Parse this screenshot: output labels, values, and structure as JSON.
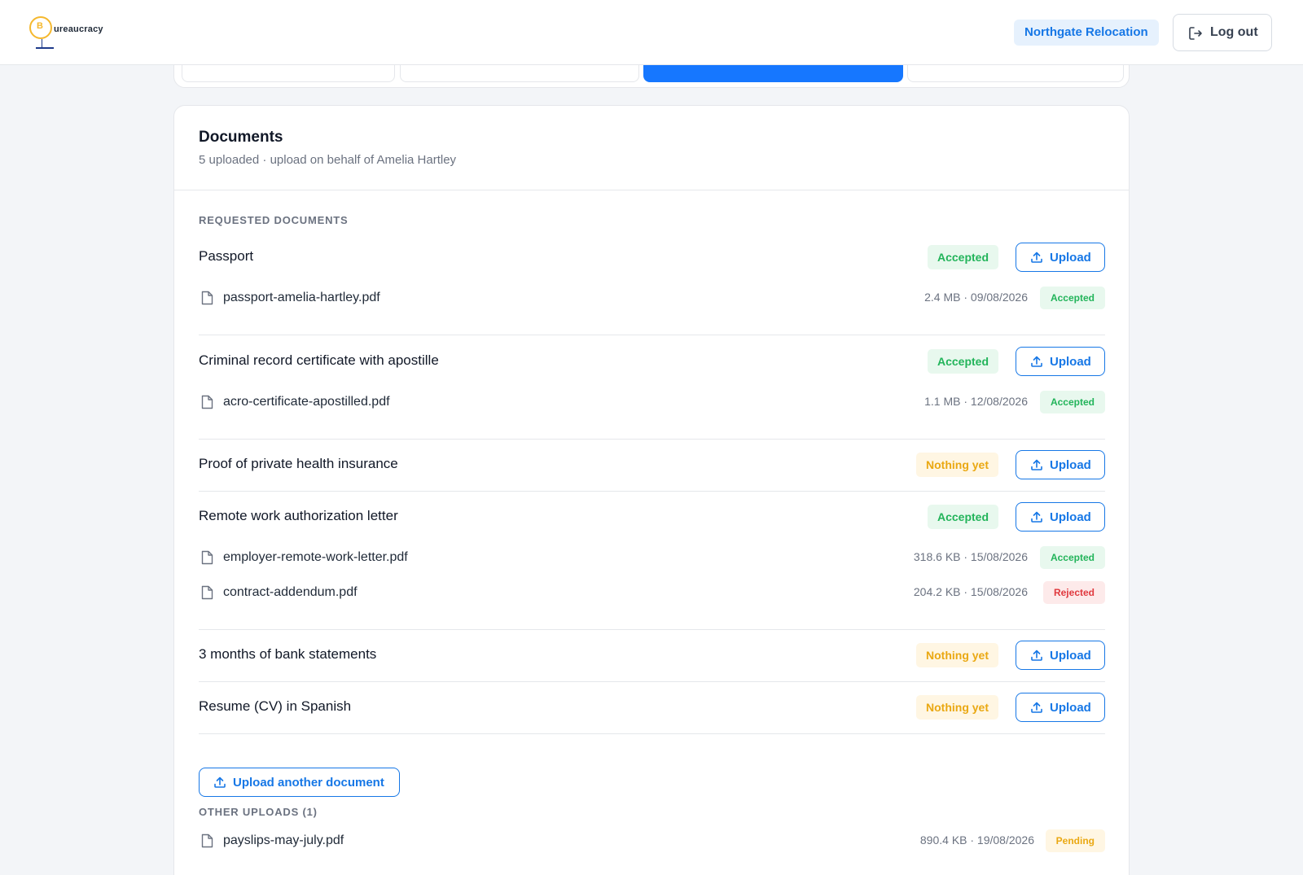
{
  "header": {
    "logo_letter": "B",
    "logo_text": "ureaucracy",
    "org_name": "Northgate Relocation",
    "logout_label": "Log out"
  },
  "documents": {
    "title": "Documents",
    "subtitle": "5 uploaded · upload on behalf of Amelia Hartley",
    "requested_label": "REQUESTED DOCUMENTS",
    "upload_label": "Upload",
    "upload_another_label": "Upload another document",
    "other_uploads_label": "OTHER UPLOADS (1)",
    "requested": [
      {
        "title": "Passport",
        "status": "Accepted",
        "files": [
          {
            "name": "passport-amelia-hartley.pdf",
            "meta": "2.4 MB · 09/08/2026",
            "status": "Accepted"
          }
        ]
      },
      {
        "title": "Criminal record certificate with apostille",
        "status": "Accepted",
        "files": [
          {
            "name": "acro-certificate-apostilled.pdf",
            "meta": "1.1 MB · 12/08/2026",
            "status": "Accepted"
          }
        ]
      },
      {
        "title": "Proof of private health insurance",
        "status": "Nothing yet",
        "files": []
      },
      {
        "title": "Remote work authorization letter",
        "status": "Accepted",
        "files": [
          {
            "name": "employer-remote-work-letter.pdf",
            "meta": "318.6 KB · 15/08/2026",
            "status": "Accepted"
          },
          {
            "name": "contract-addendum.pdf",
            "meta": "204.2 KB · 15/08/2026",
            "status": "Rejected"
          }
        ]
      },
      {
        "title": "3 months of bank statements",
        "status": "Nothing yet",
        "files": []
      },
      {
        "title": "Resume (CV) in Spanish",
        "status": "Nothing yet",
        "files": []
      }
    ],
    "other_uploads": [
      {
        "name": "payslips-may-july.pdf",
        "meta": "890.4 KB · 19/08/2026",
        "status": "Pending"
      }
    ]
  },
  "colors": {
    "accent": "#1677e6",
    "accepted": "#22b45a",
    "nothing_yet": "#eaa812",
    "rejected": "#e0393e",
    "pending": "#eaa812"
  },
  "icons": {
    "logout": "logout-icon",
    "upload": "upload-icon",
    "file": "file-icon"
  }
}
